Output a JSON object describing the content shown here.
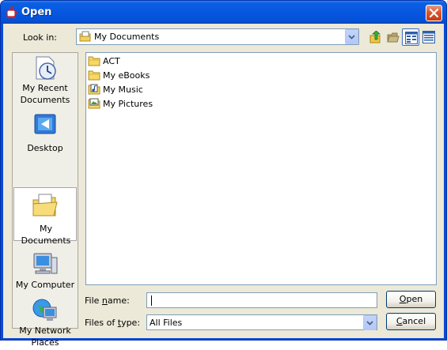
{
  "window": {
    "title": "Open"
  },
  "toolbar": {
    "look_in_label": "Look in:",
    "look_in_value": "My Documents",
    "buttons": [
      {
        "name": "up-one-level-button",
        "icon": "up-folder-icon"
      },
      {
        "name": "create-new-folder-button",
        "icon": "new-folder-icon"
      },
      {
        "name": "list-view-button",
        "icon": "list-view-icon",
        "active": true
      },
      {
        "name": "details-view-button",
        "icon": "details-view-icon"
      }
    ]
  },
  "places": [
    {
      "id": "my-recent-documents",
      "label": "My Recent Documents",
      "icon": "recent-documents-icon"
    },
    {
      "id": "desktop",
      "label": "Desktop",
      "icon": "desktop-icon"
    },
    {
      "id": "my-documents",
      "label": "My Documents",
      "icon": "my-documents-icon",
      "selected": true
    },
    {
      "id": "my-computer",
      "label": "My Computer",
      "icon": "my-computer-icon"
    },
    {
      "id": "my-network-places",
      "label": "My Network Places",
      "icon": "network-places-icon"
    }
  ],
  "files": [
    {
      "name": "ACT",
      "icon": "folder-icon"
    },
    {
      "name": "My eBooks",
      "icon": "folder-icon"
    },
    {
      "name": "My Music",
      "icon": "music-folder-icon"
    },
    {
      "name": "My Pictures",
      "icon": "pictures-folder-icon"
    }
  ],
  "form": {
    "file_name_label_pre": "File ",
    "file_name_label_u": "n",
    "file_name_label_post": "ame:",
    "file_name_value": "",
    "files_of_type_label_pre": "Files of ",
    "files_of_type_label_u": "t",
    "files_of_type_label_post": "ype:",
    "files_of_type_value": "All Files"
  },
  "buttons": {
    "open_u": "O",
    "open_rest": "pen",
    "cancel_u": "C",
    "cancel_rest": "ancel"
  },
  "colors": {
    "titlebar": "#0552d7",
    "dialog_face": "#ece9d8",
    "close_button": "#d9572f"
  }
}
